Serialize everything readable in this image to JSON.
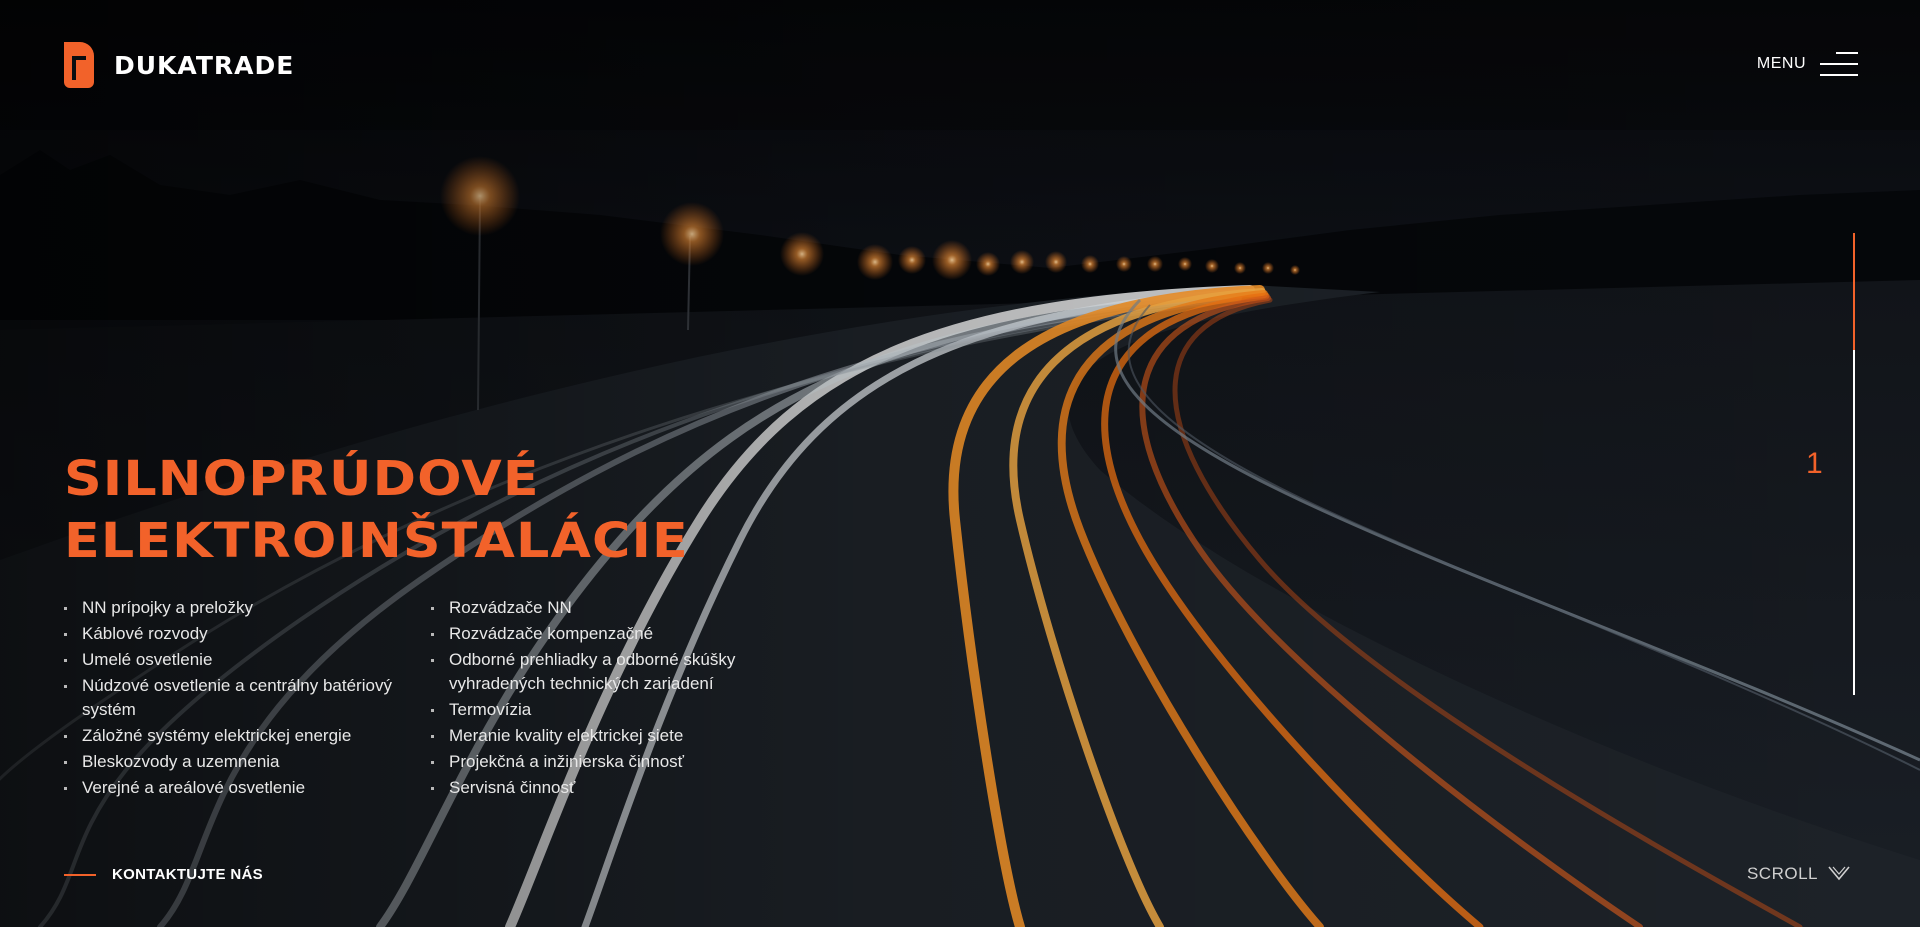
{
  "brand": {
    "name": "DUKATRADE",
    "logo_icon": "dukatrade-logo-icon",
    "accent_color": "#f2622a"
  },
  "menu": {
    "label": "MENU",
    "icon": "hamburger-icon"
  },
  "hero": {
    "title_line1": "SILNOPRÚDOVÉ",
    "title_line2": "ELEKTROINŠTALÁCIE",
    "services_col1": [
      "NN prípojky a preložky",
      "Káblové rozvody",
      "Umelé osvetlenie",
      "Núdzové osvetlenie a centrálny batériový systém",
      "Záložné systémy elektrickej energie",
      "Bleskozvody a uzemnenia",
      "Verejné a areálové osvetlenie"
    ],
    "services_col2": [
      "Rozvádzače NN",
      "Rozvádzače kompenzačné",
      "Odborné prehliadky a odborné skúšky vyhradených technických zariadení",
      "Termovízia",
      "Meranie kvality elektrickej siete",
      "Projekčná a inžinierska činnosť",
      "Servisná činnosť"
    ]
  },
  "slider": {
    "current": "1"
  },
  "footer": {
    "contact_label": "KONTAKTUJTE NÁS",
    "scroll_label": "SCROLL",
    "scroll_icon": "chevron-down-icon"
  }
}
